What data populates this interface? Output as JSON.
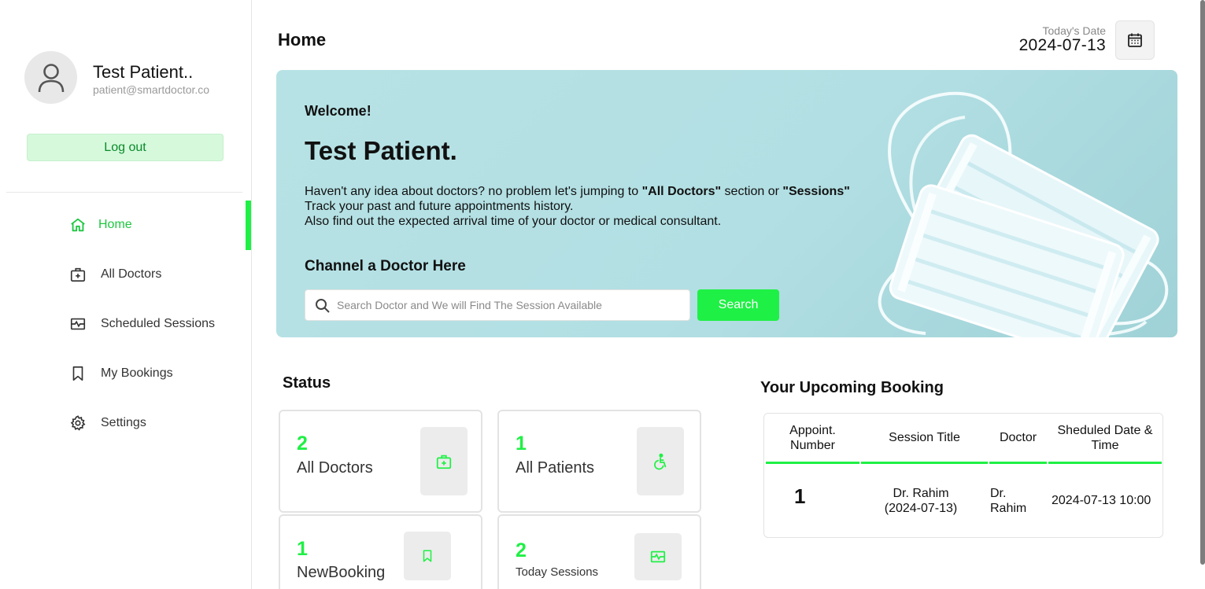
{
  "sidebar": {
    "profile": {
      "name": "Test Patient..",
      "email": "patient@smartdoctor.co"
    },
    "logout_label": "Log out",
    "items": [
      {
        "label": "Home",
        "icon": "home-icon",
        "active": true
      },
      {
        "label": "All Doctors",
        "icon": "doctor-case-icon",
        "active": false
      },
      {
        "label": "Scheduled Sessions",
        "icon": "session-icon",
        "active": false
      },
      {
        "label": "My Bookings",
        "icon": "bookmark-icon",
        "active": false
      },
      {
        "label": "Settings",
        "icon": "gear-icon",
        "active": false
      }
    ]
  },
  "header": {
    "title": "Home",
    "date_label": "Today's Date",
    "date_value": "2024-07-13"
  },
  "banner": {
    "welcome": "Welcome!",
    "name": "Test Patient.",
    "line1_pre": "Haven't any idea about doctors? no problem let's jumping to ",
    "line1_b1": "\"All Doctors\"",
    "line1_mid": " section or ",
    "line1_b2": "\"Sessions\"",
    "line2": "Track your past and future appointments history.",
    "line3": "Also find out the expected arrival time of your doctor or medical consultant.",
    "channel_title": "Channel a Doctor Here",
    "search_placeholder": "Search Doctor and We will Find The Session Available",
    "search_button": "Search"
  },
  "status": {
    "title": "Status",
    "cards": [
      {
        "value": "2",
        "label": "All Doctors",
        "icon": "doctor-case-icon"
      },
      {
        "value": "1",
        "label": "All Patients",
        "icon": "wheelchair-icon"
      },
      {
        "value": "1",
        "label": "NewBooking",
        "icon": "bookmark-icon"
      },
      {
        "value": "2",
        "label": "Today Sessions",
        "icon": "session-icon"
      }
    ]
  },
  "bookings": {
    "title": "Your Upcoming Booking",
    "headers": [
      "Appoint. Number",
      "Session Title",
      "Doctor",
      "Sheduled Date & Time"
    ],
    "rows": [
      {
        "number": "1",
        "session": "Dr. Rahim (2024-07-13)",
        "doctor": "Dr. Rahim",
        "datetime": "2024-07-13 10:00"
      }
    ]
  },
  "colors": {
    "accent": "#1ff045",
    "accent_text": "#1ec740",
    "logout_bg": "#d6f9dc",
    "banner_bg": "#b5e1e4"
  }
}
